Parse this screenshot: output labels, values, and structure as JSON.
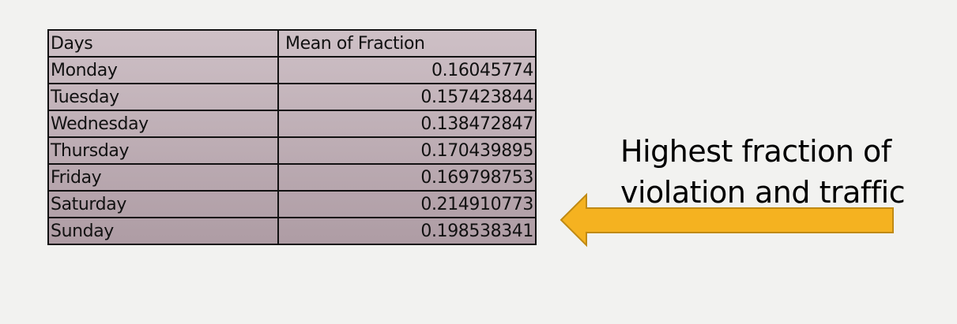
{
  "table": {
    "headers": {
      "days": "Days",
      "mean": "Mean of Fraction"
    },
    "rows": [
      {
        "day": "Monday",
        "value": "0.16045774"
      },
      {
        "day": "Tuesday",
        "value": "0.157423844"
      },
      {
        "day": "Wednesday",
        "value": "0.138472847"
      },
      {
        "day": "Thursday",
        "value": "0.170439895"
      },
      {
        "day": "Friday",
        "value": "0.169798753"
      },
      {
        "day": "Saturday",
        "value": "0.214910773"
      },
      {
        "day": "Sunday",
        "value": "0.198538341"
      }
    ]
  },
  "callout": {
    "line1": "Highest fraction of",
    "line2": "violation and traffic"
  },
  "colors": {
    "arrow_fill": "#f5b220",
    "arrow_stroke": "#c08a14",
    "background": "#f2f2f0"
  }
}
